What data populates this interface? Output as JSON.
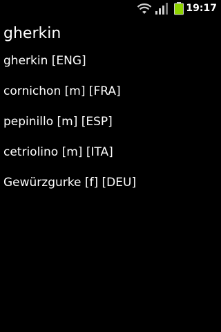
{
  "status_bar": {
    "time": "19:17",
    "icons": [
      "wifi-icon",
      "signal-icon",
      "battery-icon"
    ],
    "battery_color": "#8fd400"
  },
  "title": "gherkin",
  "translations": [
    "gherkin [ENG]",
    "cornichon [m] [FRA]",
    "pepinillo [m] [ESP]",
    "cetriolino [m] [ITA]",
    "Gewürzgurke [f] [DEU]"
  ]
}
